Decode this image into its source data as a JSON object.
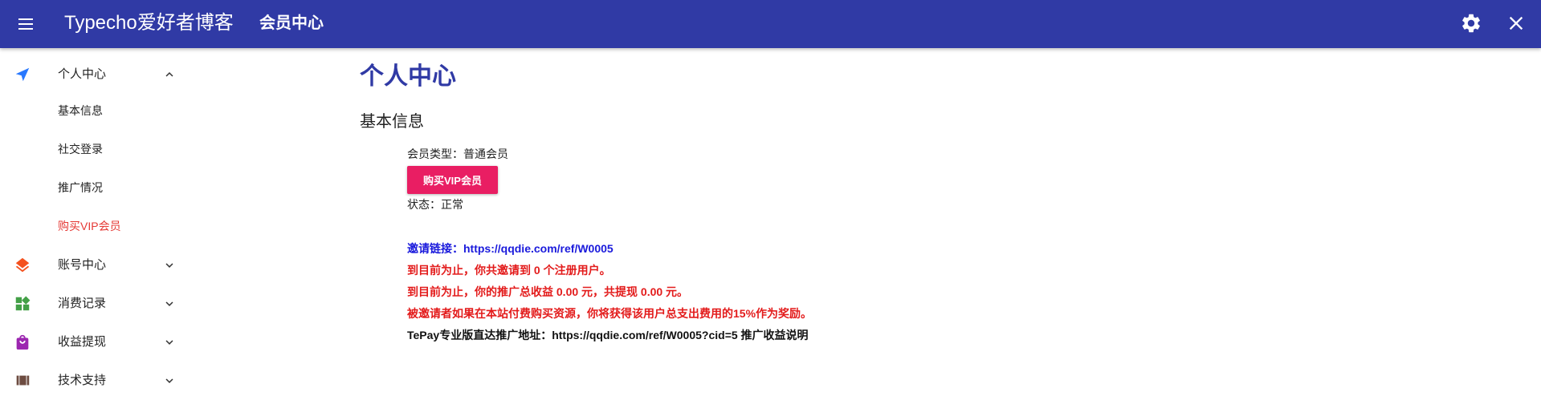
{
  "appbar": {
    "site_title": "Typecho爱好者博客",
    "page_subtitle": "会员中心",
    "menu_icon": "menu-icon",
    "settings_icon": "gear-icon",
    "close_icon": "close-icon",
    "background_color": "#303aa5"
  },
  "sidebar": {
    "groups": [
      {
        "label": "个人中心",
        "icon": "send-icon",
        "icon_color": "#2979ff",
        "expanded": true,
        "children": [
          {
            "label": "基本信息",
            "active": false
          },
          {
            "label": "社交登录",
            "active": false
          },
          {
            "label": "推广情况",
            "active": false
          },
          {
            "label": "购买VIP会员",
            "active": true
          }
        ]
      },
      {
        "label": "账号中心",
        "icon": "layers-icon",
        "icon_color": "#f4511e",
        "expanded": false
      },
      {
        "label": "消费记录",
        "icon": "widgets-icon",
        "icon_color": "#43a047",
        "expanded": false
      },
      {
        "label": "收益提现",
        "icon": "shopping-bag-icon",
        "icon_color": "#9c27b0",
        "expanded": false
      },
      {
        "label": "技术支持",
        "icon": "view-array-icon",
        "icon_color": "#6d4c41",
        "expanded": false
      }
    ],
    "active_color": "#e53935"
  },
  "main": {
    "title": "个人中心",
    "section_title": "基本信息",
    "member_type": "会员类型：普通会员",
    "buy_vip_button": "购买VIP会员",
    "status": "状态：正常",
    "invite_label": "邀请链接：",
    "invite_link": "https://qqdie.com/ref/W0005",
    "invited_count_text": "到目前为止，你共邀请到 0 个注册用户。",
    "earnings_text": "到目前为止，你的推广总收益 0.00 元，共提现 0.00 元。",
    "reward_text": "被邀请者如果在本站付费购买资源，你将获得该用户总支出费用的15%作为奖励。",
    "tepay_label": "TePay专业版直达推广地址：",
    "tepay_link": "https://qqdie.com/ref/W0005?cid=5",
    "promo_explain_link": "推广收益说明",
    "colors": {
      "title": "#303aa5",
      "vip_button": "#e91e63",
      "link_blue": "#1a1adc",
      "text_red": "#e31b1b"
    }
  }
}
